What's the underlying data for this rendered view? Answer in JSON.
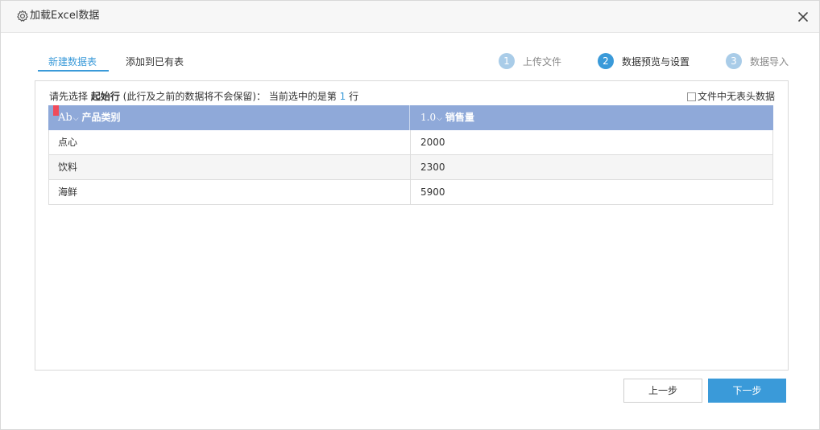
{
  "window": {
    "title": "加载Excel数据",
    "title_icon": "gear-icon",
    "close_icon": "close-icon"
  },
  "tabs": [
    {
      "label": "新建数据表",
      "active": true
    },
    {
      "label": "添加到已有表",
      "active": false
    }
  ],
  "steps": [
    {
      "number": "1",
      "label": "上传文件",
      "state": "done"
    },
    {
      "number": "2",
      "label": "数据预览与设置",
      "state": "current"
    },
    {
      "number": "3",
      "label": "数据导入",
      "state": "pending"
    }
  ],
  "instruction": {
    "prefix": "请先选择 ",
    "bold": "起始行",
    "middle": " (此行及之前的数据将不会保留)：  当前选中的是第 ",
    "row_number": "1",
    "suffix": " 行"
  },
  "no_header_checkbox": {
    "label": "文件中无表头数据",
    "checked": false
  },
  "table": {
    "columns": [
      {
        "type_label": "Ab",
        "name": "产品类别"
      },
      {
        "type_label": "1.0",
        "name": "销售量"
      }
    ],
    "rows": [
      [
        "点心",
        "2000"
      ],
      [
        "饮料",
        "2300"
      ],
      [
        "海鲜",
        "5900"
      ]
    ]
  },
  "footer": {
    "prev_label": "上一步",
    "next_label": "下一步"
  },
  "colors": {
    "accent": "#3a9ad9",
    "header_bg": "#8fa9d9",
    "flag": "#f04b5b"
  }
}
